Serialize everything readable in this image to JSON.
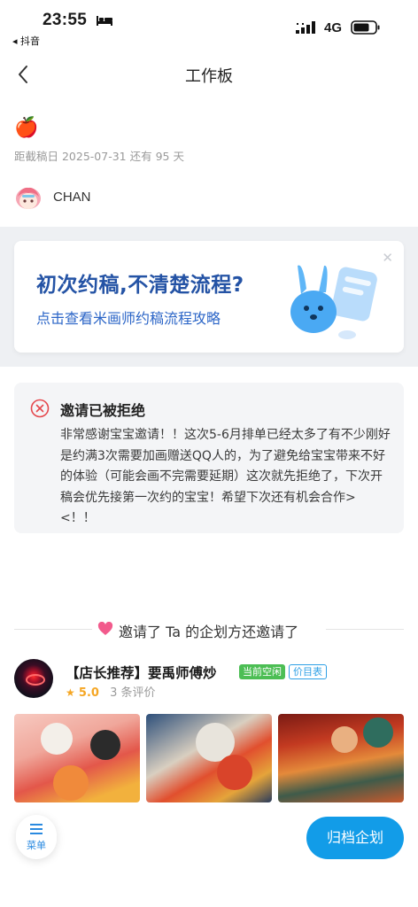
{
  "status_bar": {
    "time": "23:55",
    "back_app": "◂ 抖音",
    "network": "4G",
    "icons": [
      "bed-icon",
      "signal-icon",
      "battery-icon"
    ]
  },
  "nav": {
    "title": "工作板",
    "back_icon": "chevron-left-icon"
  },
  "order": {
    "emoji": "🍎",
    "deadline_text": "距截稿日 2025-07-31 还有 95 天"
  },
  "artist": {
    "name": "CHAN"
  },
  "banner": {
    "title": "初次约稿,不清楚流程?",
    "subtitle": "点击查看米画师约稿流程攻略",
    "close": "✕"
  },
  "rejection": {
    "title": "邀请已被拒绝",
    "message": "非常感谢宝宝邀请！！这次5-6月排单已经太多了有不少刚好是约满3次需要加画赠送QQ人的，为了避免给宝宝带来不好的体验（可能会画不完需要延期）这次就先拒绝了，下次开稿会优先接第一次约的宝宝！希望下次还有机会合作> <！！"
  },
  "invited_section": {
    "label": "邀请了 Ta 的企划方还邀请了"
  },
  "shop": {
    "name": "【店长推荐】要禹师傅炒",
    "tag_free": "当前空闲",
    "tag_price": "价目表",
    "rating": "5.0",
    "review_count": "3 条评价",
    "star": "★"
  },
  "bottom": {
    "menu_icon": "☰",
    "menu_label": "菜单",
    "archive_label": "归档企划"
  },
  "colors": {
    "accent_blue": "#129ce8",
    "banner_title": "#2453a5",
    "reject_red": "#e5484d",
    "free_green": "#4cbe54",
    "rating_gold": "#f5a623"
  }
}
